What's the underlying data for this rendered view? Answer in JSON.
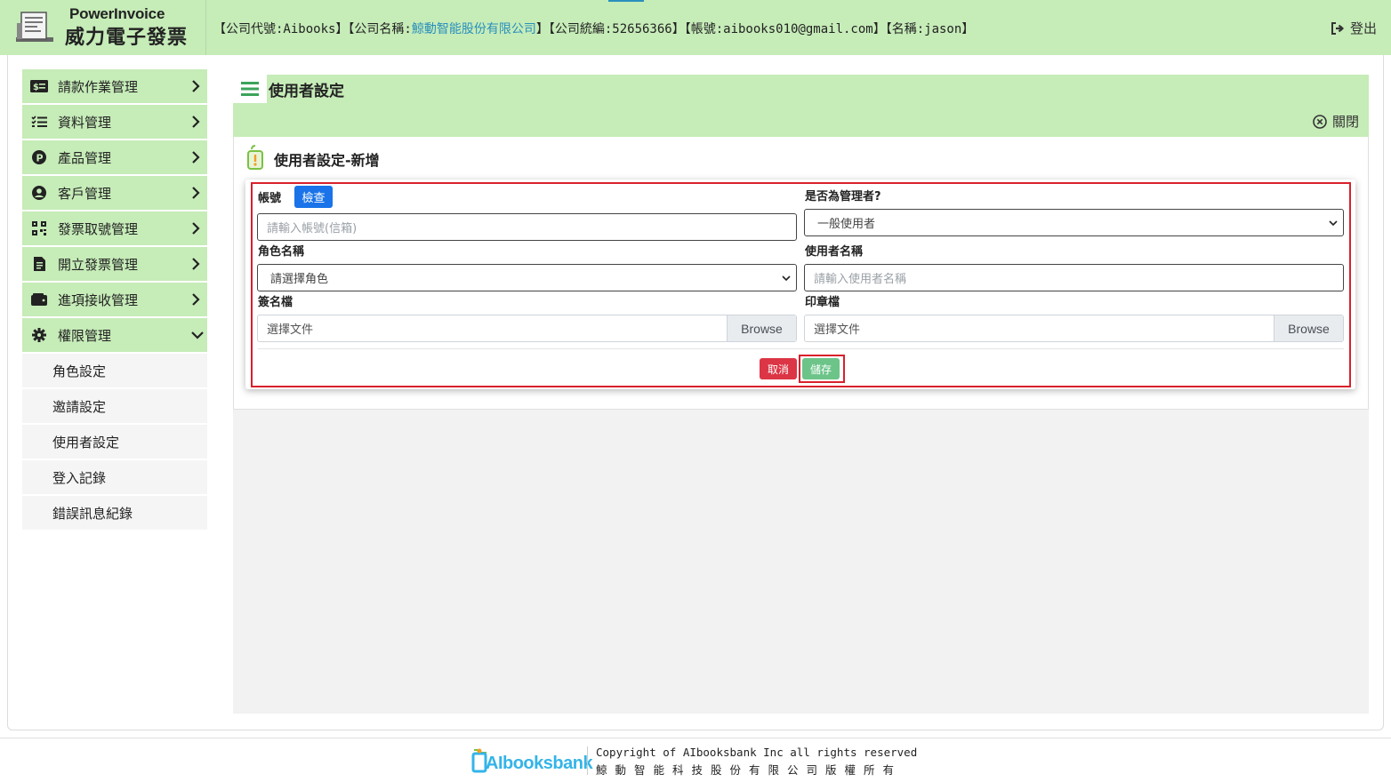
{
  "app": {
    "logo_en": "PowerInvoice",
    "logo_zh": "威力電子發票"
  },
  "header": {
    "company_info_prefix": "【公司代號:Aibooks】【公司名稱:",
    "company_name": "鯨動智能股份有限公司",
    "company_info_suffix": "】【公司統編:52656366】【帳號:aibooks010@gmail.com】【名稱:jason】",
    "logout_label": "登出"
  },
  "sidebar": {
    "items": [
      {
        "label": "請款作業管理",
        "icon": "invoice-dollar-icon"
      },
      {
        "label": "資料管理",
        "icon": "list-check-icon"
      },
      {
        "label": "產品管理",
        "icon": "product-p-icon"
      },
      {
        "label": "客戶管理",
        "icon": "user-circle-icon"
      },
      {
        "label": "發票取號管理",
        "icon": "qrcode-icon"
      },
      {
        "label": "開立發票管理",
        "icon": "file-invoice-icon"
      },
      {
        "label": "進項接收管理",
        "icon": "wallet-icon"
      },
      {
        "label": "權限管理",
        "icon": "gear-icon"
      }
    ],
    "sub_items": [
      {
        "label": "角色設定"
      },
      {
        "label": "邀請設定"
      },
      {
        "label": "使用者設定"
      },
      {
        "label": "登入記錄"
      },
      {
        "label": "錯誤訊息紀錄"
      }
    ]
  },
  "page": {
    "title": "使用者設定",
    "close_label": "關閉",
    "panel_title": "使用者設定-新增"
  },
  "form": {
    "account_label": "帳號",
    "check_label": "檢查",
    "account_placeholder": "請輸入帳號(信箱)",
    "is_admin_label": "是否為管理者?",
    "is_admin_value": "一般使用者",
    "role_label": "角色名稱",
    "role_value": "請選擇角色",
    "username_label": "使用者名稱",
    "username_placeholder": "請輸入使用者名稱",
    "signature_label": "簽名檔",
    "signature_placeholder": "選擇文件",
    "seal_label": "印章檔",
    "seal_placeholder": "選擇文件",
    "browse_label": "Browse",
    "cancel_label": "取消",
    "save_label": "儲存"
  },
  "footer": {
    "brand": "AIbooksbank",
    "copyright": "Copyright of AIbooksbank Inc all rights reserved",
    "copyright_zh": "鯨動智能科技股份有限公司版權所有"
  },
  "colors": {
    "header_green": "#c6ecb8",
    "accent_blue": "#1a73e8",
    "danger_red": "#dc3545",
    "save_green": "#6cc489",
    "highlight_red": "#d9202b"
  }
}
